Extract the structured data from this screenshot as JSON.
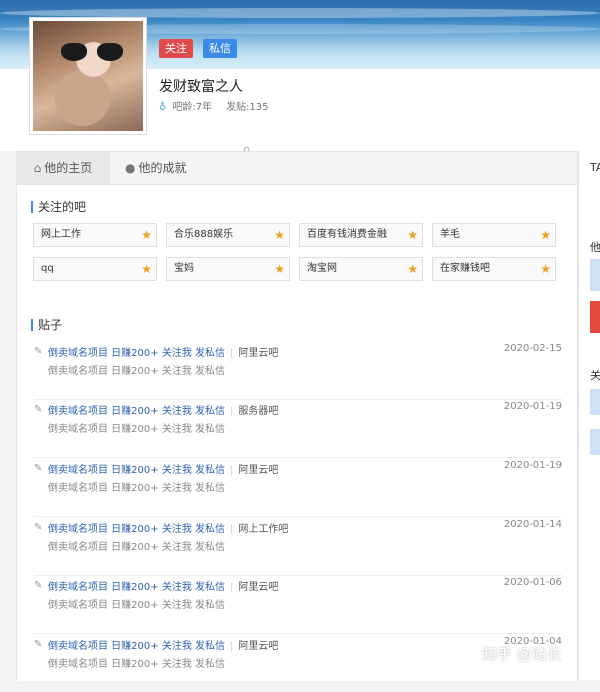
{
  "profile": {
    "follow_label": "关注",
    "message_label": "私信",
    "username": "发财致富之人",
    "gender_glyph": "♀",
    "ba_age": "吧龄:7年",
    "post_count": "发贴:135"
  },
  "tabs": {
    "home": "他的主页",
    "achievements": "他的成就"
  },
  "followed_bars": {
    "title": "关注的吧",
    "items": [
      "网上工作",
      "合乐888娱乐",
      "百度有钱消费金融",
      "羊毛",
      "qq",
      "宝妈",
      "淘宝网",
      "在家赚钱吧"
    ]
  },
  "posts": {
    "title": "贴子",
    "items": [
      {
        "title": "倒卖域名项目 日赚200+ 关注我 发私信",
        "forum": "阿里云吧",
        "desc": "倒卖域名项目 日赚200+ 关注我 发私信",
        "date": "2020-02-15"
      },
      {
        "title": "倒卖域名项目 日赚200+ 关注我 发私信",
        "forum": "服务器吧",
        "desc": "倒卖域名项目 日赚200+ 关注我 发私信",
        "date": "2020-01-19"
      },
      {
        "title": "倒卖域名项目 日赚200+ 关注我 发私信",
        "forum": "阿里云吧",
        "desc": "倒卖域名项目 日赚200+ 关注我 发私信",
        "date": "2020-01-19"
      },
      {
        "title": "倒卖域名项目 日赚200+ 关注我 发私信",
        "forum": "网上工作吧",
        "desc": "倒卖域名项目 日赚200+ 关注我 发私信",
        "date": "2020-01-14"
      },
      {
        "title": "倒卖域名项目 日赚200+ 关注我 发私信",
        "forum": "阿里云吧",
        "desc": "倒卖域名项目 日赚200+ 关注我 发私信",
        "date": "2020-01-06"
      },
      {
        "title": "倒卖域名项目 日赚200+ 关注我 发私信",
        "forum": "阿里云吧",
        "desc": "倒卖域名项目 日赚200+ 关注我 发私信",
        "date": "2020-01-04"
      }
    ]
  },
  "right_panel": {
    "t1": "TA",
    "t2": "他",
    "t3": "关"
  },
  "watermark": "知乎 @站长",
  "colors": {
    "follow": "#e24b4b",
    "message": "#3b8ae6",
    "link": "#2d64b3",
    "star": "#f0a01e"
  },
  "icons": {
    "home": "home-icon",
    "achievements": "user-icon",
    "star": "star-icon",
    "edit": "edit-icon",
    "ba": "person-icon"
  }
}
